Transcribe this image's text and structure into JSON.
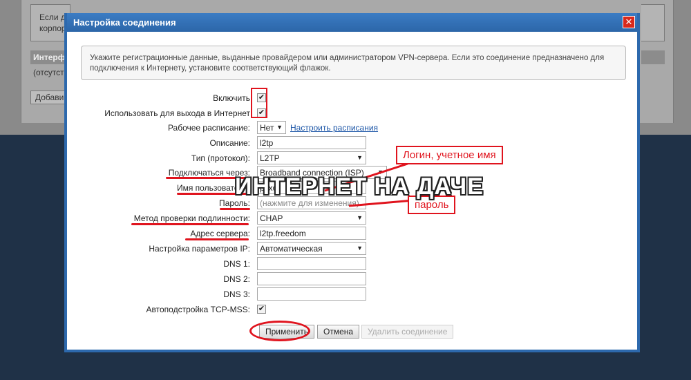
{
  "background": {
    "note_line1": "Если д",
    "note_line2": "корпор",
    "header": "Интерф",
    "row": "(отсутст",
    "button": "Добави"
  },
  "dialog": {
    "title": "Настройка соединения",
    "close_glyph": "✕",
    "info_text": "Укажите регистрационные данные, выданные провайдером или администратором VPN-сервера. Если это соединение предназначено для подключения к Интернету, установите соответствующий флажок."
  },
  "form": {
    "enable": {
      "label": "Включить",
      "checked": true
    },
    "internet": {
      "label": "Использовать для выхода в Интернет",
      "checked": true
    },
    "schedule": {
      "label": "Рабочее расписание:",
      "value": "Нет",
      "link": "Настроить расписания"
    },
    "description": {
      "label": "Описание:",
      "value": "l2tp"
    },
    "type": {
      "label": "Тип (протокол):",
      "value": "L2TP"
    },
    "connect_via": {
      "label": "Подключаться через:",
      "value": "Broadband connection (ISP)"
    },
    "username": {
      "label": "Имя пользователя:",
      "value": "pyxo"
    },
    "password": {
      "label": "Пароль:",
      "placeholder": "(нажмите для изменения)"
    },
    "auth": {
      "label": "Метод проверки подлинности:",
      "value": "CHAP"
    },
    "server": {
      "label": "Адрес сервера:",
      "value": "l2tp.freedom"
    },
    "ip_settings": {
      "label": "Настройка параметров IP:",
      "value": "Автоматическая"
    },
    "dns1": {
      "label": "DNS 1:",
      "value": ""
    },
    "dns2": {
      "label": "DNS 2:",
      "value": ""
    },
    "dns3": {
      "label": "DNS 3:",
      "value": ""
    },
    "tcp_mss": {
      "label": "Автоподстройка TCP-MSS:",
      "checked": true
    }
  },
  "buttons": {
    "apply": "Применить",
    "cancel": "Отмена",
    "delete": "Удалить соединение"
  },
  "annotations": {
    "login_callout": "Логин, учетное имя",
    "password_callout": "пароль",
    "watermark": "ИНТЕРНЕТ НА ДАЧЕ",
    "color": "#e0141e"
  }
}
